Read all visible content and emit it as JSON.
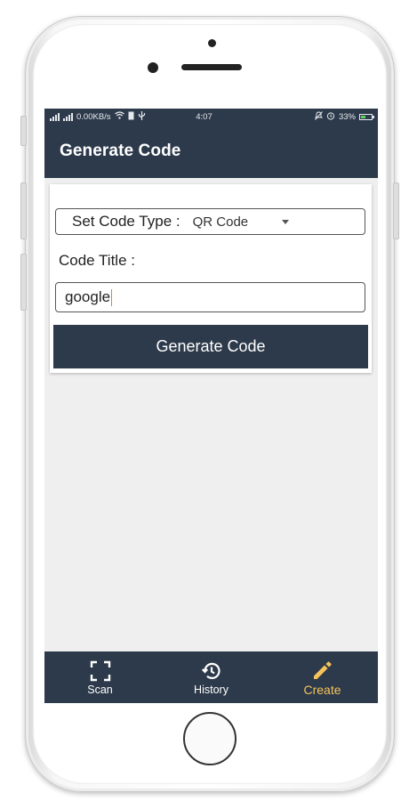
{
  "status_bar": {
    "network_speed": "0.00KB/s",
    "time": "4:07",
    "battery_percent": "33%"
  },
  "app_bar": {
    "title": "Generate Code"
  },
  "form": {
    "code_type_label": "Set Code Type :",
    "code_type_value": "QR Code",
    "code_title_label": "Code Title :",
    "code_title_value": "google",
    "generate_button_label": "Generate Code"
  },
  "bottom_nav": {
    "items": [
      {
        "label": "Scan",
        "icon": "scan-frame-icon",
        "active": false
      },
      {
        "label": "History",
        "icon": "history-icon",
        "active": false
      },
      {
        "label": "Create",
        "icon": "pencil-icon",
        "active": true
      }
    ]
  },
  "colors": {
    "primary": "#2d3a4b",
    "accent": "#f5c35a",
    "background": "#efefef"
  }
}
